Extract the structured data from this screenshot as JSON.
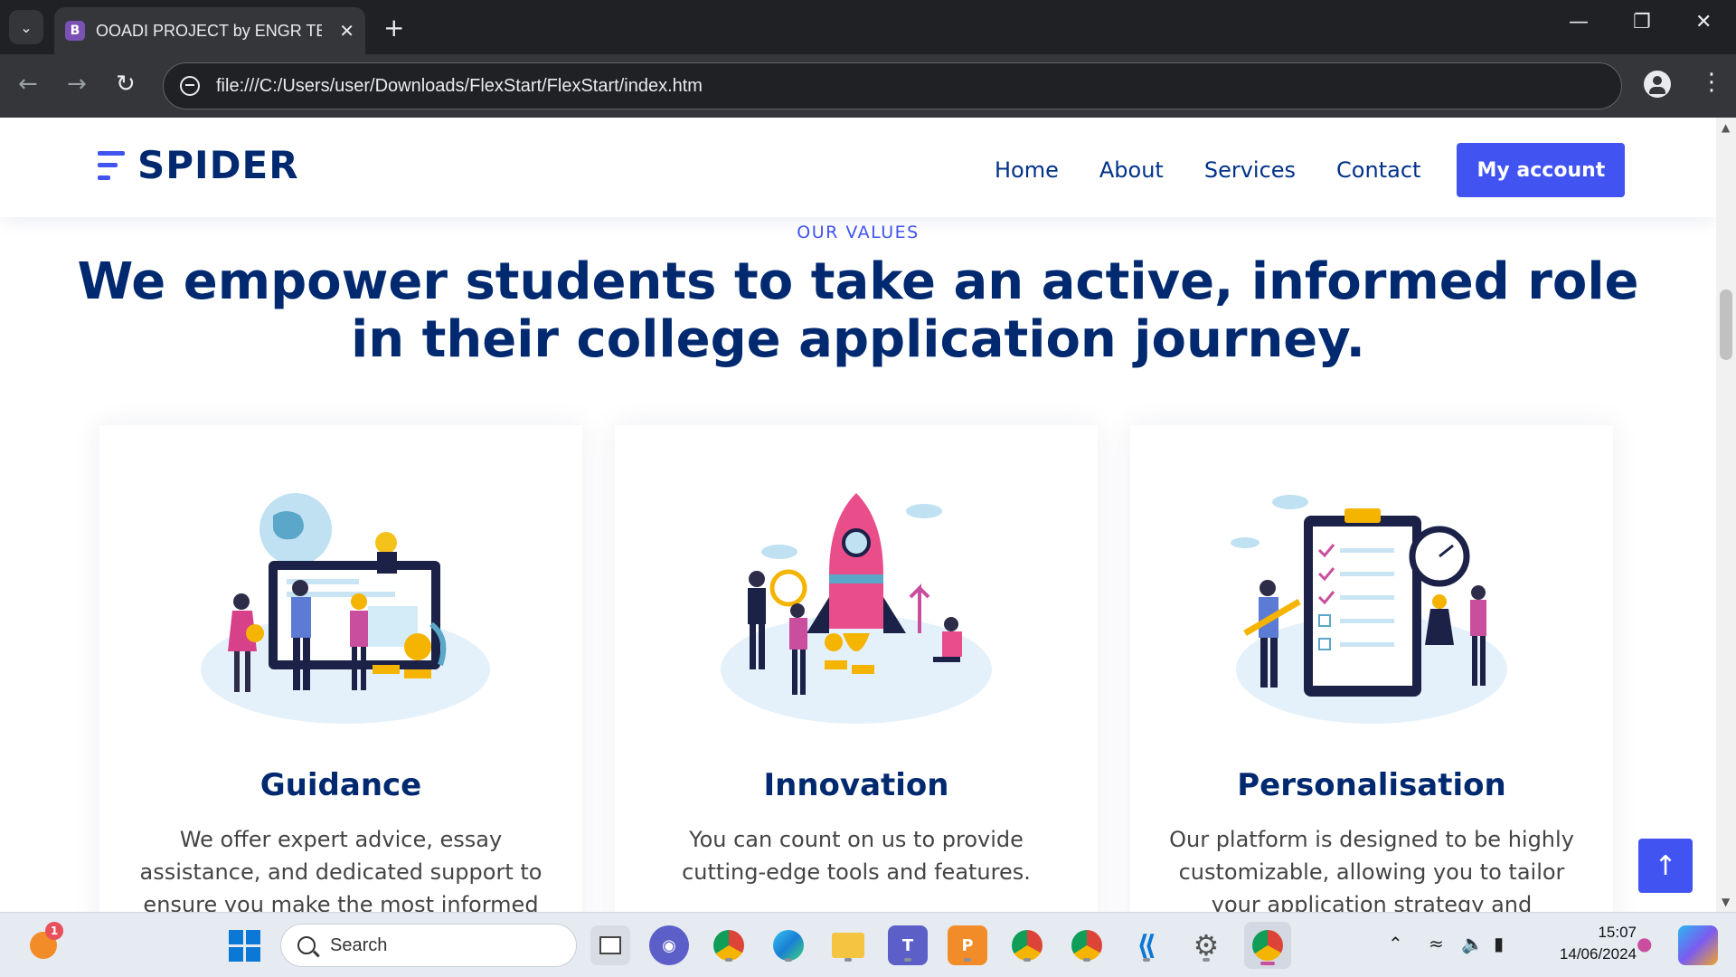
{
  "browser": {
    "tab_title": "OOADI PROJECT by ENGR TEKO",
    "tab_favicon": "B",
    "url": "file:///C:/Users/user/Downloads/FlexStart/FlexStart/index.htm"
  },
  "site": {
    "logo": "SPIDER",
    "nav": {
      "home": "Home",
      "about": "About",
      "services": "Services",
      "contact": "Contact",
      "account": "My account"
    },
    "section_label": "OUR VALUES",
    "headline": "We empower students to take an active, informed role in their college application journey.",
    "cards": [
      {
        "title": "Guidance",
        "text": "We offer expert advice, essay assistance, and dedicated support to ensure you make the most informed"
      },
      {
        "title": "Innovation",
        "text": "You can count on us to provide cutting-edge tools and features."
      },
      {
        "title": "Personalisation",
        "text": "Our platform is designed to be highly customizable, allowing you to tailor your application strategy and"
      }
    ]
  },
  "taskbar": {
    "search_placeholder": "Search",
    "time": "15:07",
    "date": "14/06/2024",
    "notification_count": "1"
  },
  "colors": {
    "brand": "#4154f1",
    "heading": "#012970",
    "chrome_dark": "#202124",
    "chrome_toolbar": "#35363a"
  }
}
